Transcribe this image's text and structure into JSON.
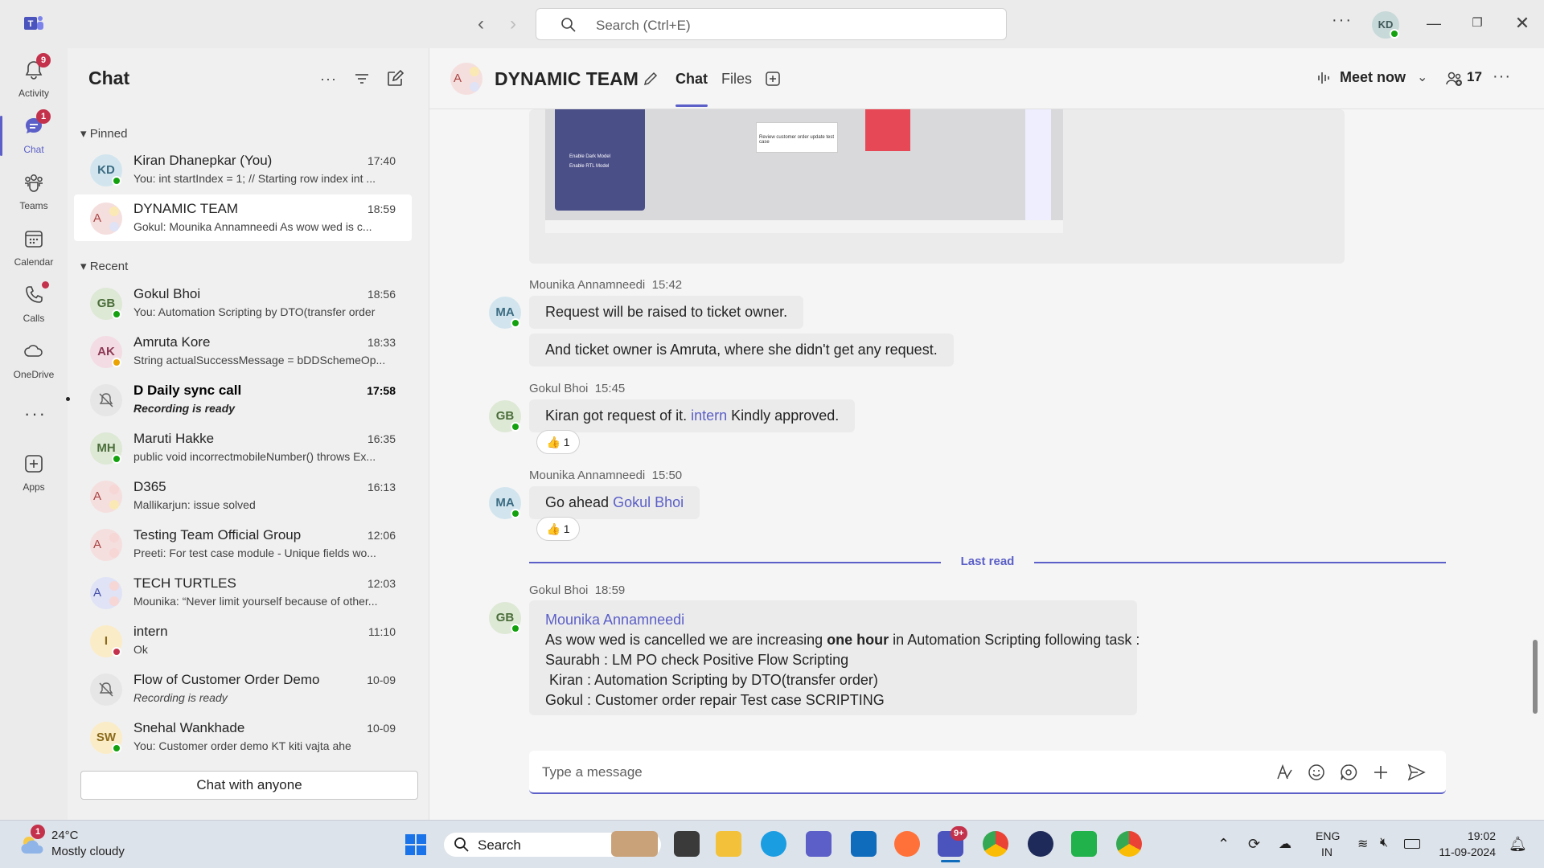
{
  "titlebar": {
    "search_placeholder": "Search (Ctrl+E)",
    "user_initials": "KD"
  },
  "rail": [
    {
      "label": "Activity",
      "badge": "9"
    },
    {
      "label": "Chat",
      "badge": "1"
    },
    {
      "label": "Teams",
      "badge": ""
    },
    {
      "label": "Calendar",
      "badge": ""
    },
    {
      "label": "Calls",
      "badge": ""
    },
    {
      "label": "OneDrive",
      "badge": ""
    },
    {
      "label": "Apps",
      "badge": ""
    }
  ],
  "chatlist": {
    "title": "Chat",
    "pinned_label": "Pinned",
    "recent_label": "Recent",
    "chat_with_anyone": "Chat with anyone",
    "pinned": [
      {
        "initials": "KD",
        "name": "Kiran Dhanepkar (You)",
        "time": "17:40",
        "preview": "You: int startIndex = 1; // Starting row index int ..."
      },
      {
        "initials": "A",
        "name": "DYNAMIC TEAM",
        "time": "18:59",
        "preview": "Gokul: Mounika Annamneedi  As wow wed is c..."
      }
    ],
    "recent": [
      {
        "initials": "GB",
        "name": "Gokul Bhoi",
        "time": "18:56",
        "preview": "You: Automation Scripting by DTO(transfer order"
      },
      {
        "initials": "AK",
        "name": "Amruta Kore",
        "time": "18:33",
        "preview": "String actualSuccessMessage = bDDSchemeOp..."
      },
      {
        "initials": "",
        "name": "D Daily sync call",
        "time": "17:58",
        "preview": "Recording is ready"
      },
      {
        "initials": "MH",
        "name": "Maruti Hakke",
        "time": "16:35",
        "preview": "public void incorrectmobileNumber() throws Ex..."
      },
      {
        "initials": "A",
        "name": "D365",
        "time": "16:13",
        "preview": "Mallikarjun: issue solved"
      },
      {
        "initials": "A",
        "name": "Testing Team Official Group",
        "time": "12:06",
        "preview": "Preeti: For test case module - Unique fields wo..."
      },
      {
        "initials": "A",
        "name": "TECH TURTLES",
        "time": "12:03",
        "preview": "Mounika: “Never limit yourself because of other..."
      },
      {
        "initials": "I",
        "name": "intern",
        "time": "11:10",
        "preview": "Ok"
      },
      {
        "initials": "",
        "name": "Flow of Customer Order Demo",
        "time": "10-09",
        "preview": "Recording is ready"
      },
      {
        "initials": "SW",
        "name": "Snehal Wankhade",
        "time": "10-09",
        "preview": "You: Customer order demo KT kiti vajta ahe"
      }
    ]
  },
  "conversation": {
    "title": "DYNAMIC TEAM",
    "tabs": [
      "Chat",
      "Files"
    ],
    "meet_now": "Meet now",
    "participants": "17",
    "messages": [
      {
        "initials": "MA",
        "sender": "Mounika Annamneedi",
        "time": "15:42",
        "lines": [
          "Request will be raised to ticket owner.",
          "And ticket owner is Amruta, where she didn't get any request."
        ]
      },
      {
        "initials": "GB",
        "sender": "Gokul Bhoi",
        "time": "15:45",
        "before": "Kiran got request of it. ",
        "mention": "intern",
        "after": " Kindly approved.",
        "reaction": "1"
      },
      {
        "initials": "MA",
        "sender": "Mounika Annamneedi",
        "time": "15:50",
        "before": "Go ahead ",
        "mention": "Gokul Bhoi",
        "reaction": "1"
      },
      {
        "initials": "GB",
        "sender": "Gokul Bhoi",
        "time": "18:59",
        "mention": "Mounika Annamneedi",
        "line1_a": "As wow wed is cancelled we are increasing ",
        "line1_b": "one hour",
        "line1_c": " in Automation Scripting following task :",
        "lines": [
          "Saurabh : LM PO check Positive Flow Scripting",
          " Kiran : Automation Scripting by DTO(transfer order)",
          "Gokul : Customer order repair Test case SCRIPTING"
        ]
      }
    ],
    "last_read": "Last read",
    "compose_placeholder": "Type a message",
    "image_texts": {
      "dark": "Enable Dark Model",
      "rtl": "Enable RTL Model",
      "order": "Review customer order update test case"
    }
  },
  "taskbar": {
    "temp": "24°C",
    "weather": "Mostly cloudy",
    "weather_badge": "1",
    "search": "Search",
    "teams_badge": "9+",
    "lang1": "ENG",
    "lang2": "IN",
    "time": "19:02",
    "date": "11-09-2024"
  },
  "colors": {
    "accent": "#5b5fc7",
    "online": "#13a10e",
    "away": "#eaa300",
    "busy": "#c4314b"
  }
}
